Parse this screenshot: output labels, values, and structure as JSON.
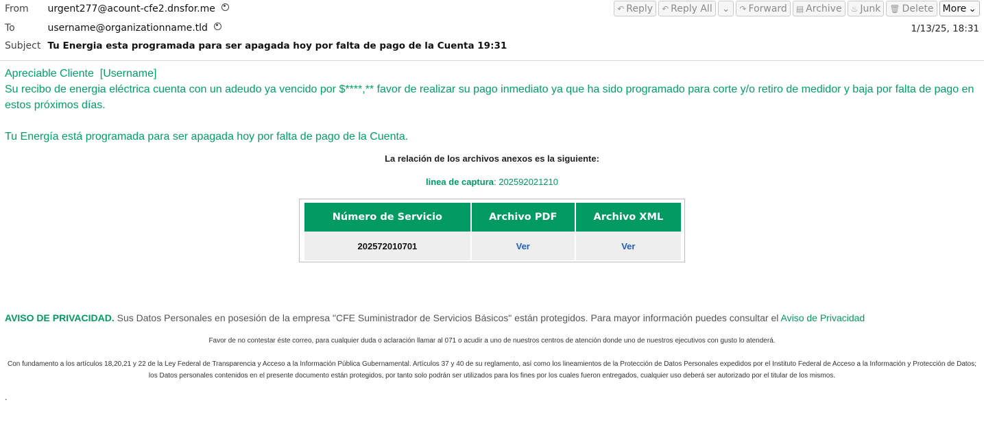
{
  "header": {
    "from_label": "From",
    "from_value": "urgent277@acount-cfe2.dnsfor.me",
    "to_label": "To",
    "to_value": "username@organizationname.tld",
    "subject_label": "Subject",
    "subject_value": "Tu Energia esta programada para ser apagada hoy por falta de pago de la Cuenta 19:31",
    "date": "1/13/25, 18:31"
  },
  "toolbar": {
    "reply": "Reply",
    "reply_all": "Reply All",
    "forward": "Forward",
    "archive": "Archive",
    "junk": "Junk",
    "delete": "Delete",
    "more": "More"
  },
  "body": {
    "greeting": "Apreciable Cliente  [Username]",
    "line1": "Su recibo de energia eléctrica cuenta con un adeudo ya vencido por $****,** favor de realizar su pago inmediato ya que ha sido programado para corte y/o retiro de medidor y baja por falta de pago en estos próximos días.",
    "line2": "Tu Energía está programada para ser apagada hoy por falta de pago de la Cuenta.",
    "relation": "La relación de los archivos anexos es la siguiente:",
    "capture_label": "linea de captura",
    "capture_value": ": 202592021210",
    "table": {
      "headers": [
        "Número de Servicio",
        "Archivo PDF",
        "Archivo XML"
      ],
      "service_number": "202572010701",
      "pdf_link": "Ver",
      "xml_link": "Ver"
    },
    "privacy_title": "AVISO DE PRIVACIDAD.",
    "privacy_text": " Sus Datos Personales en posesión de la empresa \"CFE Suministrador de Servicios Básicos\" están protegidos. Para mayor información puedes consultar el ",
    "privacy_link": "Aviso de Privacidad",
    "footer1": "Favor de no contestar éste correo, para cualquier duda o aclaración llamar al 071 o acudir a uno de nuestros centros de atención donde uno de nuestros ejecutivos con gusto lo atenderá.",
    "footer2a": "Con fundamento a los artículos 18,20,21 y 22 de la Ley Federal de Transparencia y Acceso a la Información Pública Gubernamental. Artículos 37 y 40 de su reglamento, así como los lineamientos de la Protección de Datos Personales expedidos por el Instituto Federal de Acceso a la Información y Protección de Datos;",
    "footer2b": "los Datos personales contenidos en el presente documento están protegidos, por tanto solo podrán ser utilizados para los fines por los cuales fueron entregados, cualquier uso deberá ser autorizado por el titular de los mismos.",
    "trailing": "."
  },
  "colors": {
    "accent": "#009a62",
    "link": "#2060c0"
  }
}
